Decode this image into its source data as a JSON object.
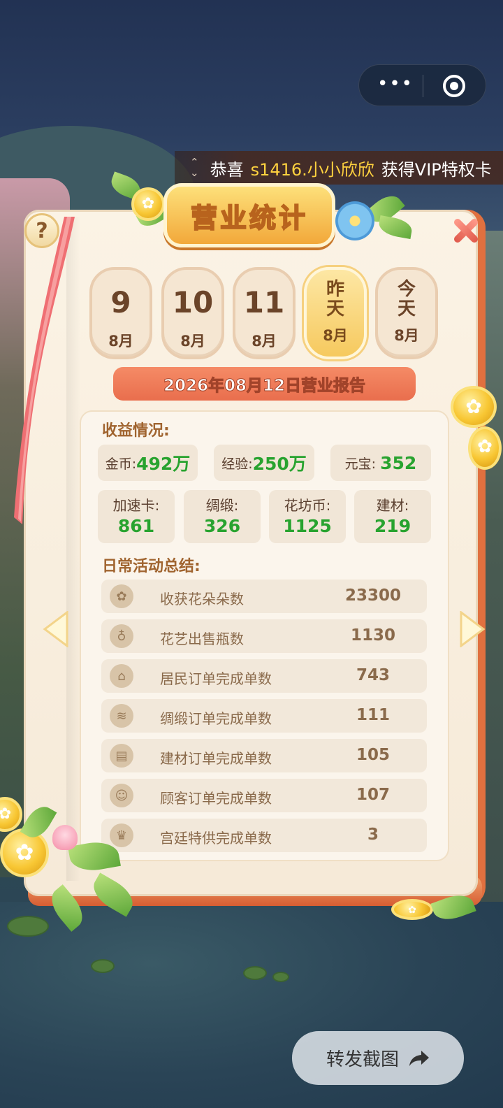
{
  "capsule": {
    "more_icon": "more-dots-icon",
    "close_icon": "target-icon"
  },
  "ticker": {
    "prefix": "恭喜",
    "username": "s1416.小小欣欣",
    "suffix": "获得VIP特权卡"
  },
  "panel": {
    "title": "营业统计",
    "help_label": "?"
  },
  "date_tabs": [
    {
      "day": "9",
      "month": "8月",
      "selected": false
    },
    {
      "day": "10",
      "month": "8月",
      "selected": false
    },
    {
      "day": "11",
      "month": "8月",
      "selected": false
    },
    {
      "day": "昨天",
      "month": "8月",
      "selected": true
    },
    {
      "day": "今天",
      "month": "8月",
      "selected": false
    }
  ],
  "report_title": "2026年08月12日营业报告",
  "income": {
    "heading": "收益情况:",
    "top": [
      {
        "label": "金币:",
        "value": "492万"
      },
      {
        "label": "经验:",
        "value": "250万"
      },
      {
        "label": "元宝: ",
        "value": "352"
      }
    ],
    "bottom": [
      {
        "label": "加速卡:",
        "value": "861"
      },
      {
        "label": "绸缎:",
        "value": "326"
      },
      {
        "label": "花坊币:",
        "value": "1125"
      },
      {
        "label": "建材:",
        "value": "219"
      }
    ]
  },
  "activities": {
    "heading": "日常活动总结:",
    "rows": [
      {
        "icon": "flower-icon",
        "label": "收获花朵朵数",
        "value": "23300"
      },
      {
        "icon": "vase-icon",
        "label": "花艺出售瓶数",
        "value": "1130"
      },
      {
        "icon": "house-icon",
        "label": "居民订单完成单数",
        "value": "743"
      },
      {
        "icon": "scroll-icon",
        "label": "绸缎订单完成单数",
        "value": "111"
      },
      {
        "icon": "bricks-icon",
        "label": "建材订单完成单数",
        "value": "105"
      },
      {
        "icon": "customer-icon",
        "label": "顾客订单完成单数",
        "value": "107"
      },
      {
        "icon": "palace-icon",
        "label": "宫廷特供完成单数",
        "value": "3"
      }
    ]
  },
  "share_button": {
    "label": "转发截图",
    "icon": "share-arrow-icon"
  },
  "colors": {
    "value_green": "#28a32f",
    "title_orange": "#f2a83a",
    "banner_red": "#e96e4d",
    "book_cover": "#e0703f"
  }
}
